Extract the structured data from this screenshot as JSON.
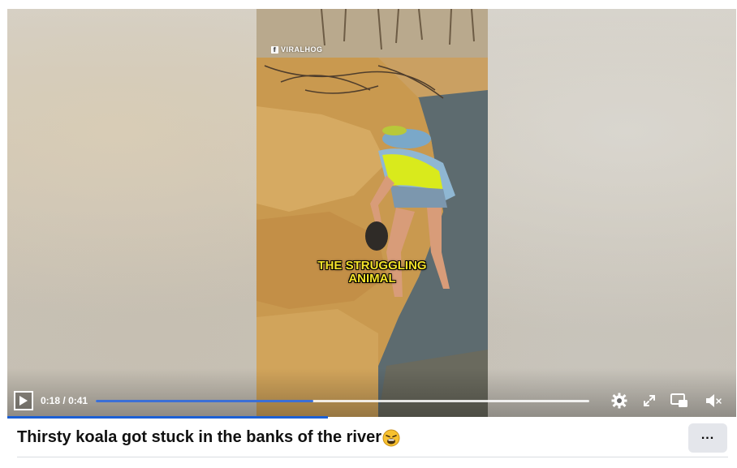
{
  "video": {
    "watermark": "VIRALHOG",
    "watermark_logo": "f",
    "caption_line1": "THE STRUGGLING",
    "caption_line2": "ANIMAL",
    "current_time": "0:18",
    "separator": "/",
    "duration": "0:41",
    "progress_fraction": 0.44
  },
  "controls": {
    "play_icon": "play-icon",
    "settings_icon": "gear-icon",
    "fullscreen_icon": "expand-icon",
    "pip_icon": "picture-in-picture-icon",
    "volume_icon": "volume-muted-icon"
  },
  "post": {
    "title": "Thirsty koala got stuck in the banks of the river",
    "title_emoji": "weary-face-emoji",
    "more_label": "..."
  },
  "colors": {
    "accent": "#1b5fd4",
    "caption": "#f5e32a",
    "more_bg": "#e4e6eb"
  }
}
